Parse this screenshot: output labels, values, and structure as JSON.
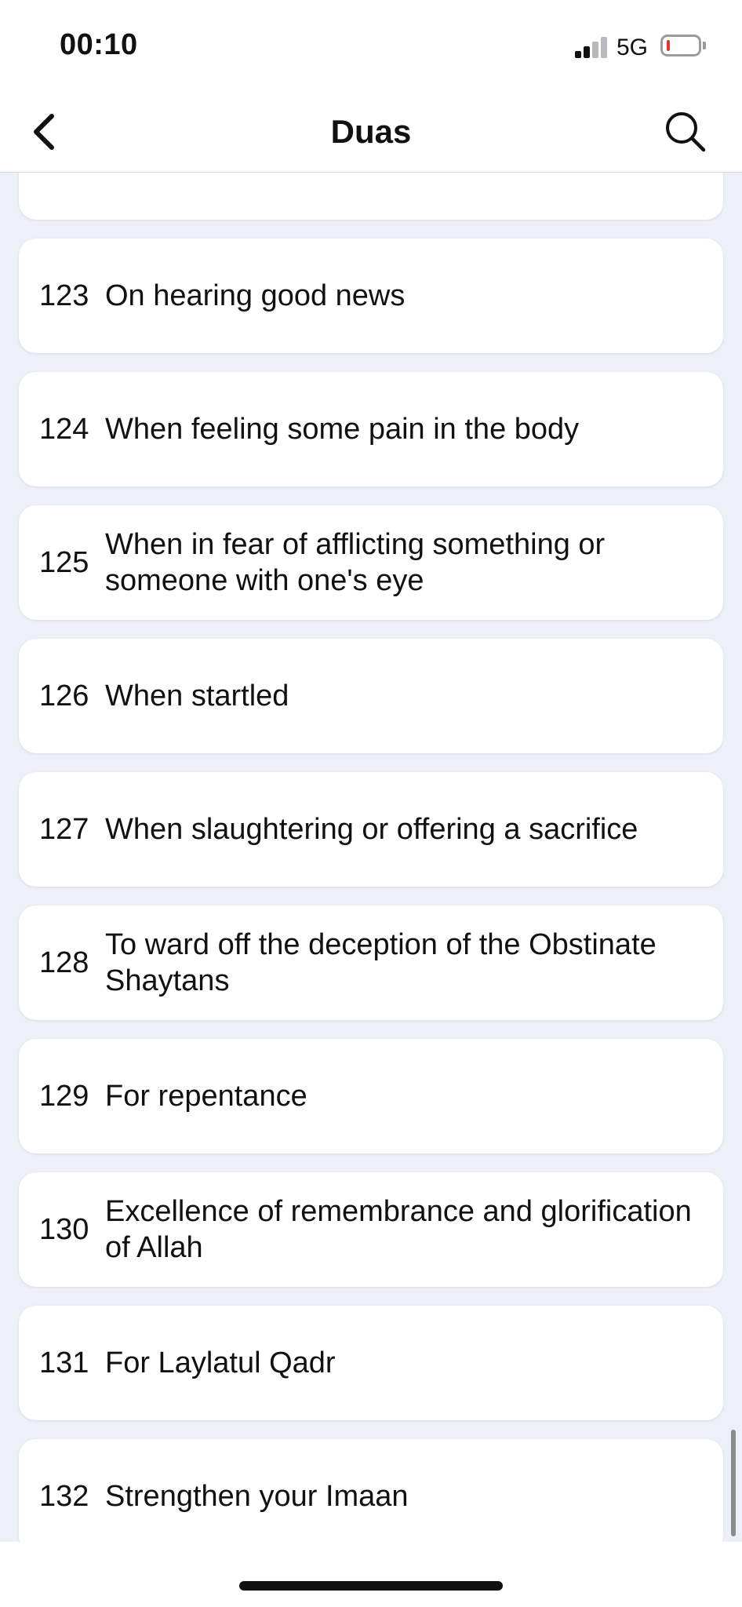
{
  "status_bar": {
    "time": "00:10",
    "network": "5G",
    "signal_bars_active": 2,
    "signal_bars_total": 4,
    "battery_level_fraction": 0.1,
    "battery_color": "#e5322d"
  },
  "nav": {
    "title": "Duas",
    "back_icon": "chevron-left-icon",
    "search_icon": "search-icon"
  },
  "duas": [
    {
      "number": "",
      "title": ""
    },
    {
      "number": "123",
      "title": "On hearing good news"
    },
    {
      "number": "124",
      "title": "When feeling some pain in the body"
    },
    {
      "number": "125",
      "title": "When in fear of afflicting something or someone with one's eye"
    },
    {
      "number": "126",
      "title": "When startled"
    },
    {
      "number": "127",
      "title": "When slaughtering or offering a sacrifice"
    },
    {
      "number": "128",
      "title": "To ward off the deception of the Obstinate Shaytans"
    },
    {
      "number": "129",
      "title": "For repentance"
    },
    {
      "number": "130",
      "title": "Excellence of remembrance and glorification of Allah"
    },
    {
      "number": "131",
      "title": "For Laylatul Qadr"
    },
    {
      "number": "132",
      "title": "Strengthen your Imaan"
    }
  ],
  "colors": {
    "list_background": "#edf0f8",
    "card_background": "#ffffff",
    "text": "#111111"
  }
}
